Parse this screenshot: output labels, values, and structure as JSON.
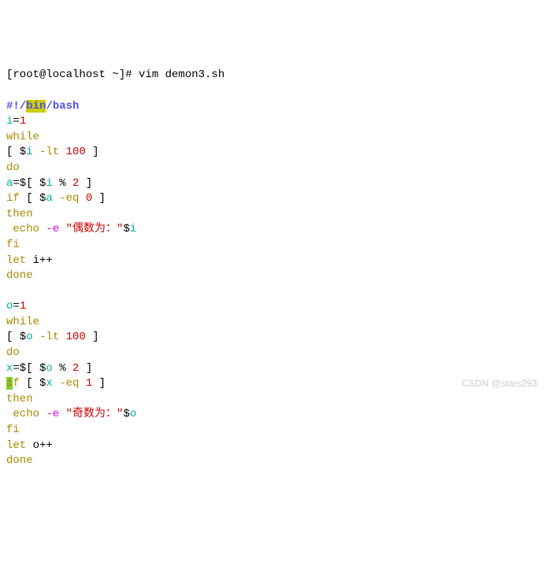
{
  "prompt": "[root@localhost ~]# vim demon3.sh",
  "shebang": {
    "hash_bang": "#!",
    "slash1": "/",
    "bin": "bin",
    "slash2": "/",
    "bash": "bash"
  },
  "block1": {
    "assign_i": {
      "var": "i",
      "eq": "=",
      "val": "1"
    },
    "while": "while",
    "cond": {
      "open": "[ $",
      "var": "i",
      "op": " -lt ",
      "num": "100",
      "close": " ]"
    },
    "do": "do",
    "assign_a": {
      "var": "a",
      "eq": "=$[ $",
      "inner": "i",
      "rest": " % ",
      "two": "2",
      "close": " ]"
    },
    "if": {
      "kw": "if",
      "open": " [ $",
      "var": "a",
      "op": " -eq ",
      "num": "0",
      "close": " ]"
    },
    "then": "then",
    "echo": {
      "sp": " ",
      "cmd": "echo",
      "opt": " -e ",
      "q1": "\"",
      "text": "偶数为：",
      "q2": "\"",
      "dollar": "$",
      "var": "i"
    },
    "fi": "fi",
    "let": {
      "kw": "let",
      "expr": " i++"
    },
    "done": "done"
  },
  "block2": {
    "assign_o": {
      "var": "o",
      "eq": "=",
      "val": "1"
    },
    "while": "while",
    "cond": {
      "open": "[ $",
      "var": "o",
      "op": " -lt ",
      "num": "100",
      "close": " ]"
    },
    "do": "do",
    "assign_x": {
      "var": "x",
      "eq": "=$[ $",
      "inner": "o",
      "rest": " % ",
      "two": "2",
      "close": " ]"
    },
    "if": {
      "i": "i",
      "f": "f",
      "open": " [ $",
      "var": "x",
      "op": " -eq ",
      "num": "1",
      "close": " ]"
    },
    "then": "then",
    "echo": {
      "sp": " ",
      "cmd": "echo",
      "opt": " -e ",
      "q1": "\"",
      "text": "奇数为：",
      "q2": "\"",
      "dollar": "$",
      "var": "o"
    },
    "fi": "fi",
    "let": {
      "kw": "let",
      "expr": " o++"
    },
    "done": "done"
  },
  "watermark": "CSDN @stars293"
}
